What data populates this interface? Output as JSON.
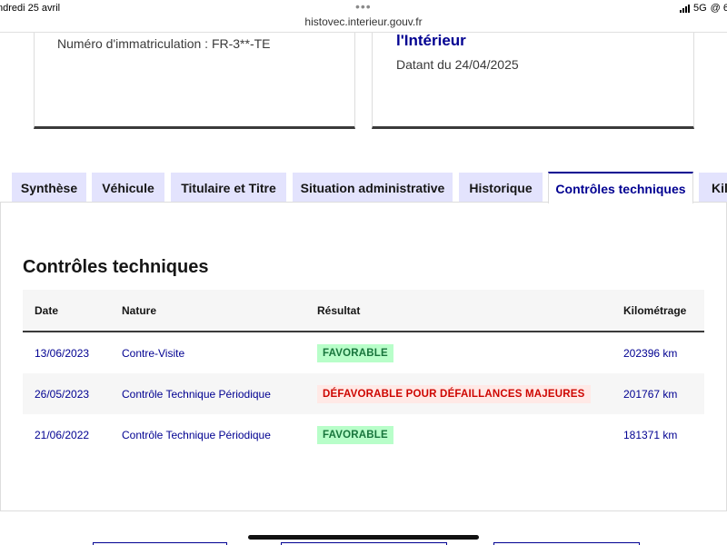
{
  "status_bar": {
    "date": "ndredi 25 avril",
    "dots": "•••",
    "network": "5G",
    "right_tail": "@ 6"
  },
  "browser": {
    "url": "histovec.interieur.gouv.fr"
  },
  "cards": {
    "registration": "Numéro d'immatriculation : FR-3**-TE",
    "organization": "l'Intérieur",
    "dated": "Datant du 24/04/2025"
  },
  "tabs": [
    {
      "label": "Synthèse",
      "active": false
    },
    {
      "label": "Véhicule",
      "active": false
    },
    {
      "label": "Titulaire et Titre",
      "active": false
    },
    {
      "label": "Situation administrative",
      "active": false
    },
    {
      "label": "Historique",
      "active": false
    },
    {
      "label": "Contrôles techniques",
      "active": true
    },
    {
      "label": "Kil",
      "active": false
    }
  ],
  "section": {
    "title": "Contrôles techniques",
    "columns": {
      "date": "Date",
      "nature": "Nature",
      "result": "Résultat",
      "km": "Kilométrage"
    },
    "rows": [
      {
        "date": "13/06/2023",
        "nature": "Contre-Visite",
        "result": "FAVORABLE",
        "result_status": "favorable",
        "km": "202396 km"
      },
      {
        "date": "26/05/2023",
        "nature": "Contrôle Technique Périodique",
        "result": "DÉFAVORABLE POUR DÉFAILLANCES MAJEURES",
        "result_status": "defavorable",
        "km": "201767 km"
      },
      {
        "date": "21/06/2022",
        "nature": "Contrôle Technique Périodique",
        "result": "FAVORABLE",
        "result_status": "favorable",
        "km": "181371 km"
      }
    ]
  },
  "colors": {
    "primary_blue": "#000091",
    "tab_background": "#e3e3fd",
    "favorable_bg": "#b8fec9",
    "favorable_text": "#18753c",
    "defavorable_bg": "#ffe9e6",
    "defavorable_text": "#ce0500"
  }
}
